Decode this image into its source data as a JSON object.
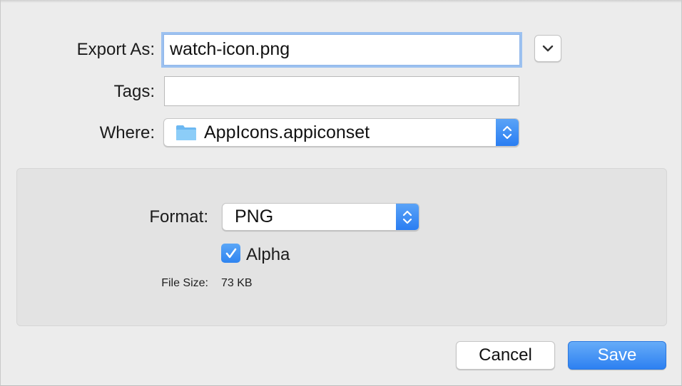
{
  "dialog": {
    "export_as_label": "Export As:",
    "export_as_value": "watch-icon.png",
    "tags_label": "Tags:",
    "tags_value": "",
    "where_label": "Where:",
    "where_value": "AppIcons.appiconset",
    "where_icon": "folder-icon"
  },
  "options": {
    "format_label": "Format:",
    "format_value": "PNG",
    "alpha_label": "Alpha",
    "alpha_checked": true,
    "file_size_label": "File Size:",
    "file_size_value": "73 KB"
  },
  "buttons": {
    "cancel_label": "Cancel",
    "save_label": "Save"
  },
  "colors": {
    "accent": "#2f84f0",
    "focus_ring": "#9cc1f0",
    "folder": "#6cb8f2"
  }
}
